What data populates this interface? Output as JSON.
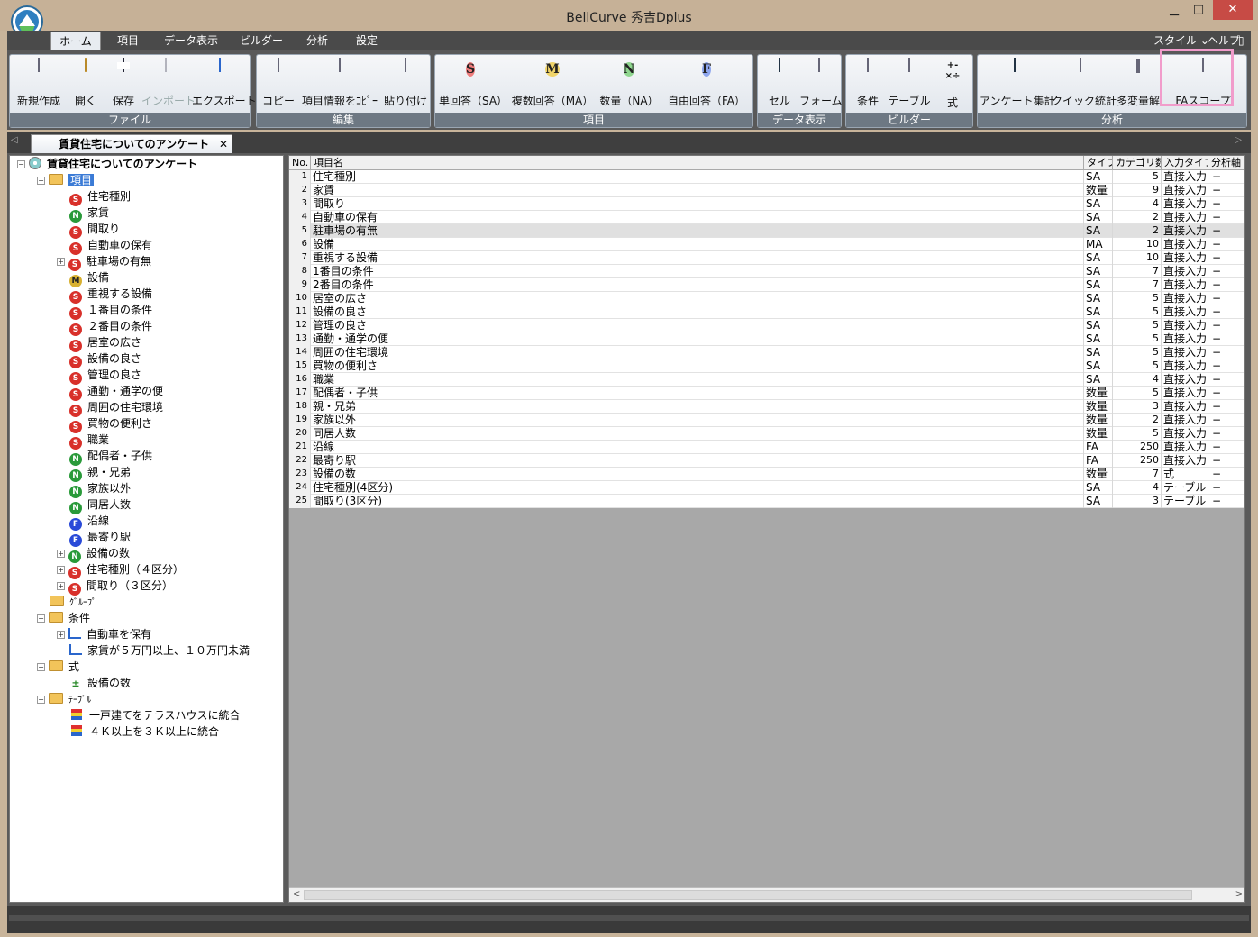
{
  "window": {
    "title": "BellCurve 秀吉Dplus",
    "minimize": "▁",
    "maximize": "□",
    "close": "✕"
  },
  "menu": {
    "tabs": [
      {
        "label": "ホーム",
        "active": true
      },
      {
        "label": "項目"
      },
      {
        "label": "データ表示"
      },
      {
        "label": "ビルダー"
      },
      {
        "label": "分析"
      },
      {
        "label": "設定"
      }
    ],
    "style": "スタイル",
    "style_arrow": "⌄",
    "help": "ヘルプ",
    "help_arrow": "⌄",
    "pin": "▯"
  },
  "ribbon": {
    "groups": {
      "file": {
        "label": "ファイル",
        "buttons": [
          "新規作成",
          "開く",
          "保存",
          "インポート",
          "エクスポート"
        ]
      },
      "edit": {
        "label": "編集",
        "buttons": [
          "コピー",
          "項目情報をｺﾋﾟｰ",
          "貼り付け"
        ]
      },
      "item": {
        "label": "項目",
        "buttons": [
          "単回答（SA）",
          "複数回答（MA）",
          "数量（NA）",
          "自由回答（FA）"
        ]
      },
      "dataview": {
        "label": "データ表示",
        "buttons": [
          "セル",
          "フォーム"
        ]
      },
      "builder": {
        "label": "ビルダー",
        "buttons": [
          "条件",
          "テーブル",
          "式"
        ]
      },
      "analysis": {
        "label": "分析",
        "buttons": [
          "アンケート集計",
          "クイック統計",
          "多変量解",
          "FAスコープ"
        ]
      }
    },
    "icon_letters": {
      "sa": "S",
      "ma": "M",
      "na": "N",
      "fa": "F"
    },
    "formula_glyph": "+-×÷"
  },
  "document_tab": {
    "label": "賃貸住宅についてのアンケート",
    "close": "✕",
    "left_arrow": "◁",
    "right_arrow": "▷"
  },
  "tree": {
    "root": "賃貸住宅についてのアンケート",
    "items_folder": "項目",
    "items": [
      {
        "label": "住宅種別",
        "type": "S"
      },
      {
        "label": "家賃",
        "type": "N"
      },
      {
        "label": "間取り",
        "type": "S"
      },
      {
        "label": "自動車の保有",
        "type": "S"
      },
      {
        "label": "駐車場の有無",
        "type": "S",
        "expandable": true
      },
      {
        "label": "設備",
        "type": "M"
      },
      {
        "label": "重視する設備",
        "type": "S"
      },
      {
        "label": "１番目の条件",
        "type": "S"
      },
      {
        "label": "２番目の条件",
        "type": "S"
      },
      {
        "label": "居室の広さ",
        "type": "S"
      },
      {
        "label": "設備の良さ",
        "type": "S"
      },
      {
        "label": "管理の良さ",
        "type": "S"
      },
      {
        "label": "通勤・通学の便",
        "type": "S"
      },
      {
        "label": "周囲の住宅環境",
        "type": "S"
      },
      {
        "label": "買物の便利さ",
        "type": "S"
      },
      {
        "label": "職業",
        "type": "S"
      },
      {
        "label": "配偶者・子供",
        "type": "N"
      },
      {
        "label": "親・兄弟",
        "type": "N"
      },
      {
        "label": "家族以外",
        "type": "N"
      },
      {
        "label": "同居人数",
        "type": "N"
      },
      {
        "label": "沿線",
        "type": "F"
      },
      {
        "label": "最寄り駅",
        "type": "F"
      },
      {
        "label": "設備の数",
        "type": "N",
        "expandable": true
      },
      {
        "label": "住宅種別（４区分）",
        "type": "S",
        "expandable": true
      },
      {
        "label": "間取り（３区分）",
        "type": "S",
        "expandable": true
      }
    ],
    "group_folder": "ｸﾞﾙｰﾌﾟ",
    "condition_folder": "条件",
    "conditions": [
      "自動車を保有",
      "家賃が５万円以上、１０万円未満"
    ],
    "formula_folder": "式",
    "formulas": [
      "設備の数"
    ],
    "table_folder": "ﾃｰﾌﾞﾙ",
    "tables": [
      "一戸建てをテラスハウスに統合",
      "４Ｋ以上を３Ｋ以上に統合"
    ],
    "expand_minus": "−",
    "expand_plus": "+"
  },
  "table": {
    "columns": [
      "No.",
      "項目名",
      "タイプ",
      "カテゴリ数",
      "入力タイプ",
      "分析軸"
    ],
    "rows": [
      {
        "no": "1",
        "name": "住宅種別",
        "type": "SA",
        "cat": "5",
        "input": "直接入力",
        "axis": "−"
      },
      {
        "no": "2",
        "name": "家賃",
        "type": "数量",
        "cat": "9",
        "input": "直接入力",
        "axis": "−"
      },
      {
        "no": "3",
        "name": "間取り",
        "type": "SA",
        "cat": "4",
        "input": "直接入力",
        "axis": "−"
      },
      {
        "no": "4",
        "name": "自動車の保有",
        "type": "SA",
        "cat": "2",
        "input": "直接入力",
        "axis": "−"
      },
      {
        "no": "5",
        "name": "駐車場の有無",
        "type": "SA",
        "cat": "2",
        "input": "直接入力",
        "axis": "−"
      },
      {
        "no": "6",
        "name": "設備",
        "type": "MA",
        "cat": "10",
        "input": "直接入力",
        "axis": "−"
      },
      {
        "no": "7",
        "name": "重視する設備",
        "type": "SA",
        "cat": "10",
        "input": "直接入力",
        "axis": "−"
      },
      {
        "no": "8",
        "name": "1番目の条件",
        "type": "SA",
        "cat": "7",
        "input": "直接入力",
        "axis": "−"
      },
      {
        "no": "9",
        "name": "2番目の条件",
        "type": "SA",
        "cat": "7",
        "input": "直接入力",
        "axis": "−"
      },
      {
        "no": "10",
        "name": "居室の広さ",
        "type": "SA",
        "cat": "5",
        "input": "直接入力",
        "axis": "−"
      },
      {
        "no": "11",
        "name": "設備の良さ",
        "type": "SA",
        "cat": "5",
        "input": "直接入力",
        "axis": "−"
      },
      {
        "no": "12",
        "name": "管理の良さ",
        "type": "SA",
        "cat": "5",
        "input": "直接入力",
        "axis": "−"
      },
      {
        "no": "13",
        "name": "通勤・通学の便",
        "type": "SA",
        "cat": "5",
        "input": "直接入力",
        "axis": "−"
      },
      {
        "no": "14",
        "name": "周囲の住宅環境",
        "type": "SA",
        "cat": "5",
        "input": "直接入力",
        "axis": "−"
      },
      {
        "no": "15",
        "name": "買物の便利さ",
        "type": "SA",
        "cat": "5",
        "input": "直接入力",
        "axis": "−"
      },
      {
        "no": "16",
        "name": "職業",
        "type": "SA",
        "cat": "4",
        "input": "直接入力",
        "axis": "−"
      },
      {
        "no": "17",
        "name": "配偶者・子供",
        "type": "数量",
        "cat": "5",
        "input": "直接入力",
        "axis": "−"
      },
      {
        "no": "18",
        "name": "親・兄弟",
        "type": "数量",
        "cat": "3",
        "input": "直接入力",
        "axis": "−"
      },
      {
        "no": "19",
        "name": "家族以外",
        "type": "数量",
        "cat": "2",
        "input": "直接入力",
        "axis": "−"
      },
      {
        "no": "20",
        "name": "同居人数",
        "type": "数量",
        "cat": "5",
        "input": "直接入力",
        "axis": "−"
      },
      {
        "no": "21",
        "name": "沿線",
        "type": "FA",
        "cat": "250",
        "input": "直接入力",
        "axis": "−"
      },
      {
        "no": "22",
        "name": "最寄り駅",
        "type": "FA",
        "cat": "250",
        "input": "直接入力",
        "axis": "−"
      },
      {
        "no": "23",
        "name": "設備の数",
        "type": "数量",
        "cat": "7",
        "input": "式",
        "axis": "−"
      },
      {
        "no": "24",
        "name": "住宅種別(4区分)",
        "type": "SA",
        "cat": "4",
        "input": "テーブル",
        "axis": "−"
      },
      {
        "no": "25",
        "name": "間取り(3区分)",
        "type": "SA",
        "cat": "3",
        "input": "テーブル",
        "axis": "−"
      }
    ],
    "selected_row": 5,
    "scroll_left": "<",
    "scroll_right": ">"
  }
}
